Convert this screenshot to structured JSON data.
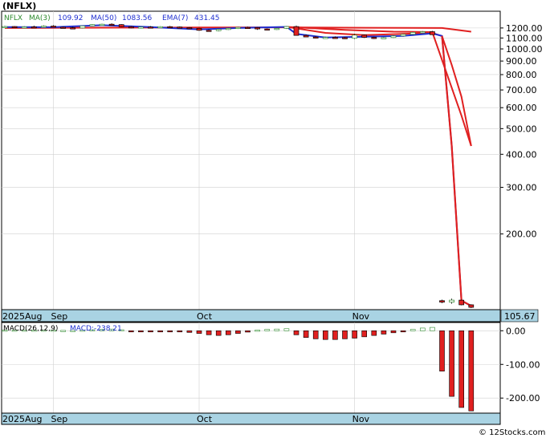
{
  "header": {
    "symbol": "(NFLX)",
    "legend_ticker": "NFLX",
    "legend_ma3": "MA(3)",
    "legend_ma3_val": "109.92",
    "legend_ma50": "MA(50)",
    "legend_ma50_val": "1083.56",
    "legend_ema7": "EMA(7)",
    "legend_ema7_val": "431.45",
    "last_price": "105.67"
  },
  "macd_header": {
    "label": "MACD(26,12,9)",
    "value": "MACD:-238.21"
  },
  "footer": {
    "copyright": "© 12Stocks.com"
  },
  "colors": {
    "up": "#2e8b2e",
    "down": "#e02020",
    "ma_line": "#e02020",
    "ma_short": "#1f2fd1",
    "axis_band": "#a9d3e3",
    "grid": "#d0d0d0"
  },
  "chart_data": [
    {
      "type": "candlestick",
      "scale": "log",
      "ylim": [
        105,
        1350
      ],
      "yticks": [
        "1200.00",
        "1100.00",
        "1000.00",
        "900.00",
        "800.00",
        "700.00",
        "600.00",
        "500.00",
        "400.00",
        "300.00",
        "200.00"
      ],
      "ytick_values": [
        1200,
        1100,
        1000,
        900,
        800,
        700,
        600,
        500,
        400,
        300,
        200
      ],
      "xlabels": [
        "2025Aug",
        "Sep",
        "Oct",
        "Nov"
      ],
      "xlabel_index": [
        0,
        5,
        20,
        36
      ],
      "candles": [
        [
          1210,
          1222,
          1205,
          1215
        ],
        [
          1215,
          1220,
          1200,
          1205
        ],
        [
          1205,
          1218,
          1198,
          1212
        ],
        [
          1212,
          1225,
          1206,
          1210
        ],
        [
          1210,
          1228,
          1204,
          1220
        ],
        [
          1220,
          1230,
          1215,
          1208
        ],
        [
          1208,
          1215,
          1198,
          1202
        ],
        [
          1202,
          1212,
          1190,
          1200
        ],
        [
          1200,
          1225,
          1196,
          1222
        ],
        [
          1222,
          1240,
          1218,
          1236
        ],
        [
          1236,
          1245,
          1228,
          1240
        ],
        [
          1240,
          1250,
          1232,
          1236
        ],
        [
          1236,
          1240,
          1210,
          1214
        ],
        [
          1214,
          1220,
          1196,
          1200
        ],
        [
          1200,
          1212,
          1194,
          1210
        ],
        [
          1210,
          1220,
          1202,
          1206
        ],
        [
          1206,
          1218,
          1200,
          1214
        ],
        [
          1214,
          1222,
          1206,
          1210
        ],
        [
          1210,
          1216,
          1200,
          1204
        ],
        [
          1204,
          1210,
          1190,
          1196
        ],
        [
          1196,
          1202,
          1170,
          1176
        ],
        [
          1176,
          1188,
          1162,
          1172
        ],
        [
          1172,
          1190,
          1166,
          1186
        ],
        [
          1186,
          1200,
          1180,
          1196
        ],
        [
          1196,
          1212,
          1190,
          1206
        ],
        [
          1206,
          1214,
          1196,
          1204
        ],
        [
          1204,
          1208,
          1180,
          1190
        ],
        [
          1190,
          1196,
          1176,
          1184
        ],
        [
          1184,
          1200,
          1180,
          1196
        ],
        [
          1196,
          1220,
          1190,
          1215
        ],
        [
          1215,
          1225,
          1140,
          1125
        ],
        [
          1125,
          1135,
          1112,
          1110
        ],
        [
          1110,
          1118,
          1096,
          1100
        ],
        [
          1100,
          1112,
          1094,
          1106
        ],
        [
          1106,
          1115,
          1098,
          1104
        ],
        [
          1104,
          1110,
          1090,
          1098
        ],
        [
          1098,
          1140,
          1090,
          1128
        ],
        [
          1128,
          1134,
          1100,
          1106
        ],
        [
          1106,
          1112,
          1090,
          1100
        ],
        [
          1100,
          1110,
          1092,
          1104
        ],
        [
          1104,
          1126,
          1100,
          1120
        ],
        [
          1120,
          1140,
          1114,
          1136
        ],
        [
          1136,
          1160,
          1130,
          1155
        ],
        [
          1155,
          1168,
          1150,
          1162
        ],
        [
          1162,
          1170,
          1130,
          1132
        ],
        [
          112,
          113,
          109.5,
          110.5
        ],
        [
          110.5,
          114,
          109,
          112.5
        ],
        [
          112.5,
          112.8,
          107.5,
          108
        ],
        [
          108,
          108.5,
          105,
          105.67
        ]
      ],
      "ma_long": [
        [
          0,
          1200
        ],
        [
          10,
          1203
        ],
        [
          20,
          1205
        ],
        [
          29,
          1206
        ],
        [
          37,
          1202
        ],
        [
          45,
          1200
        ],
        [
          48,
          1162
        ]
      ],
      "ma_mid": [
        [
          29,
          1212
        ],
        [
          35,
          1180
        ],
        [
          40,
          1162
        ],
        [
          44,
          1158
        ],
        [
          47,
          560
        ],
        [
          48,
          430
        ]
      ],
      "ma_short": [
        [
          0,
          1210
        ],
        [
          5,
          1208
        ],
        [
          10,
          1230
        ],
        [
          15,
          1210
        ],
        [
          20,
          1185
        ],
        [
          24,
          1200
        ],
        [
          29,
          1212
        ],
        [
          30,
          1140
        ],
        [
          33,
          1105
        ],
        [
          37,
          1112
        ],
        [
          41,
          1120
        ],
        [
          44,
          1145
        ],
        [
          45,
          1120
        ],
        [
          46,
          430
        ],
        [
          47,
          112
        ],
        [
          48,
          107
        ]
      ],
      "ema": [
        [
          29,
          1212
        ],
        [
          33,
          1150
        ],
        [
          37,
          1128
        ],
        [
          41,
          1140
        ],
        [
          44,
          1150
        ],
        [
          45,
          1118
        ],
        [
          46,
          870
        ],
        [
          47,
          660
        ],
        [
          48,
          430
        ]
      ]
    },
    {
      "type": "bar",
      "title": "MACD(26,12,9)",
      "ylim": [
        -240,
        15
      ],
      "yticks": [
        "0.00",
        "-100.00",
        "-200.00"
      ],
      "ytick_values": [
        0,
        -100,
        -200
      ],
      "values": [
        2,
        2,
        2,
        2,
        2,
        2,
        1,
        1,
        2,
        3,
        4,
        5,
        3,
        -2,
        -3,
        -3,
        -2,
        -2,
        -3,
        -5,
        -8,
        -12,
        -14,
        -12,
        -8,
        -4,
        2,
        4,
        5,
        6,
        -12,
        -20,
        -24,
        -26,
        -26,
        -24,
        -22,
        -18,
        -14,
        -10,
        -6,
        -2,
        4,
        8,
        10,
        -120,
        -195,
        -228,
        -238.21
      ]
    }
  ]
}
